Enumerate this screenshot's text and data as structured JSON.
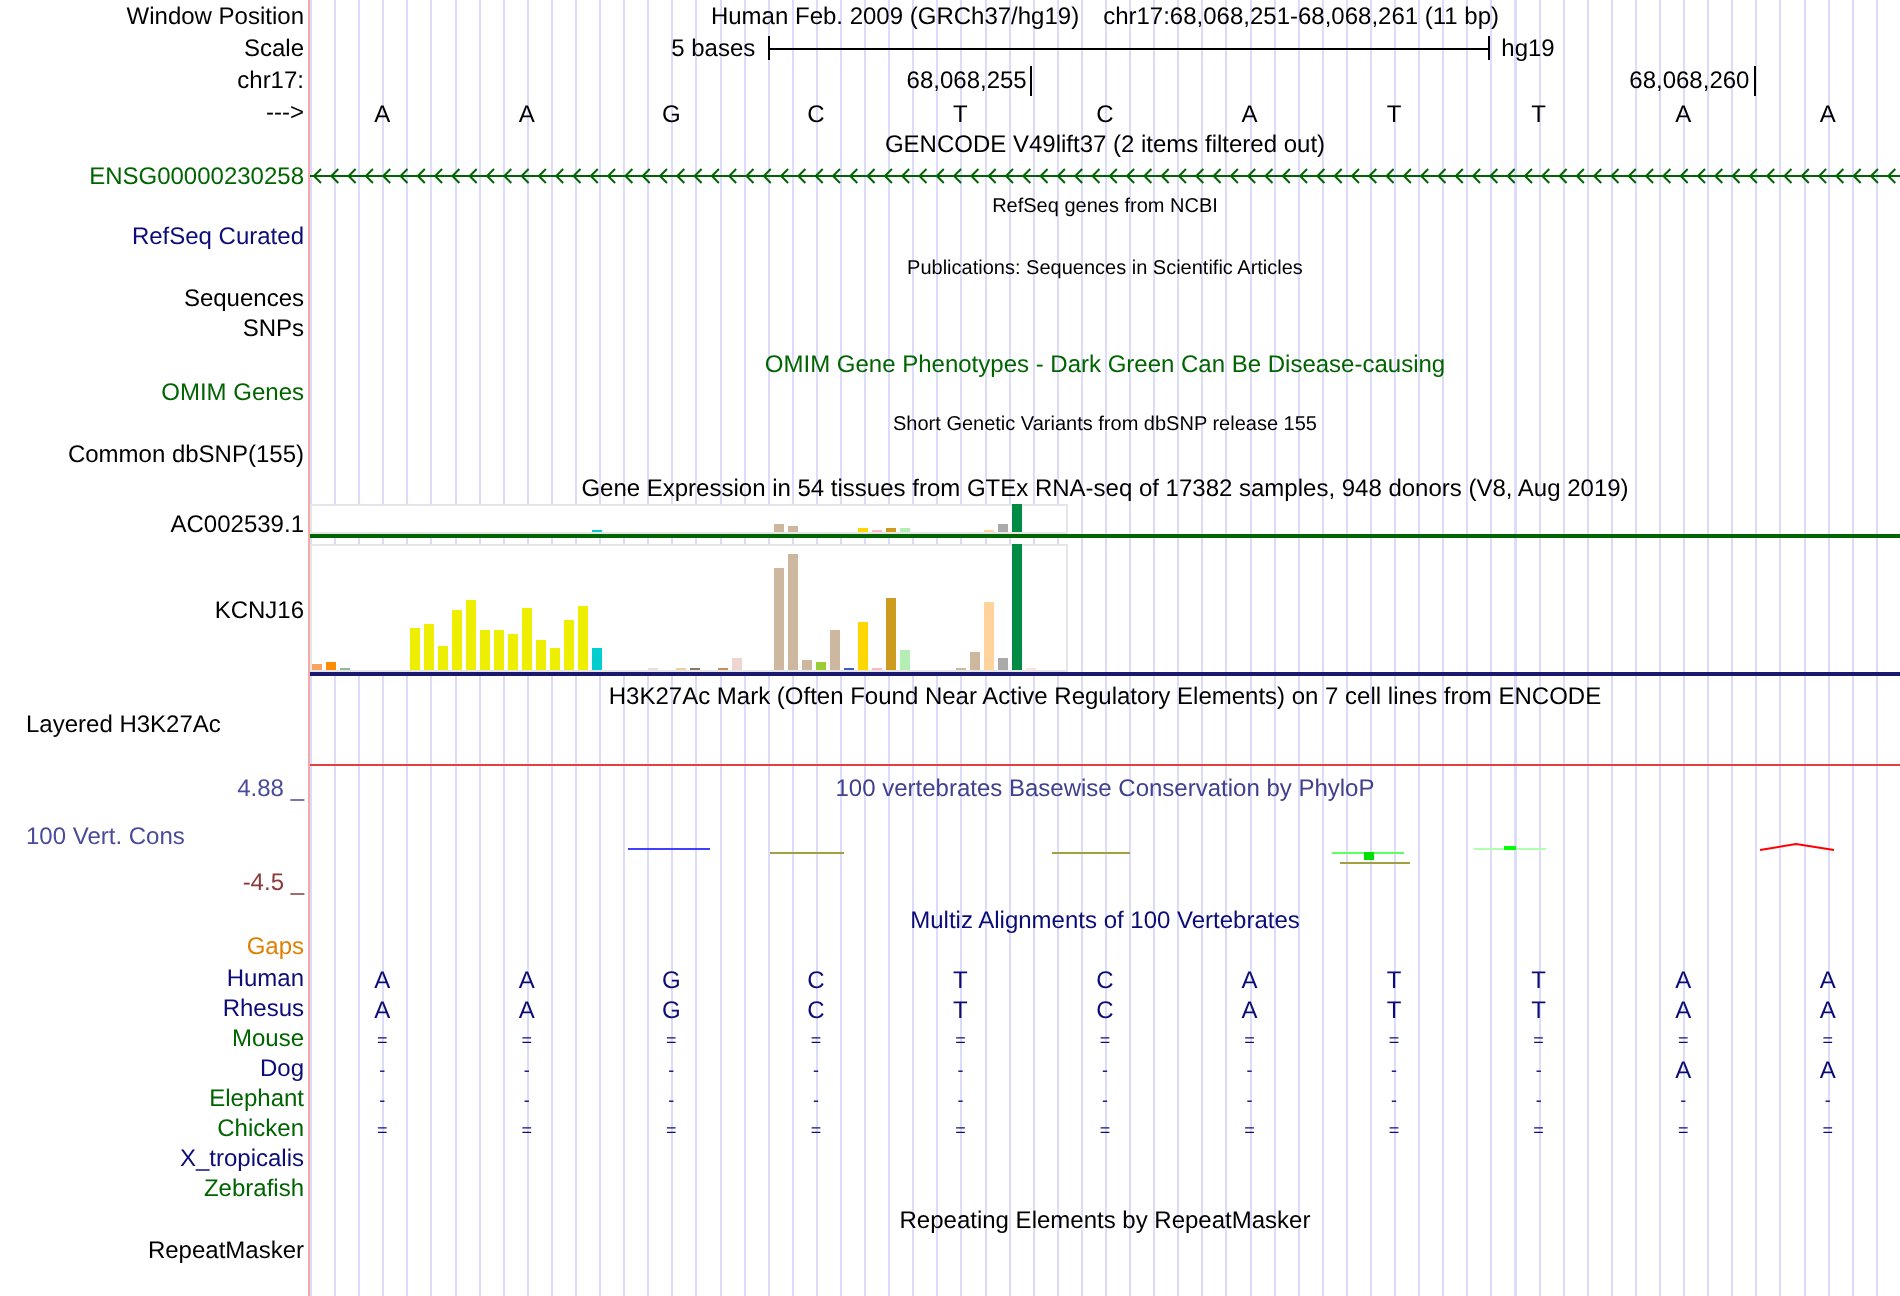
{
  "window_position": {
    "label": "Window Position",
    "assembly": "Human Feb. 2009 (GRCh37/hg19)",
    "range": "chr17:68,068,251-68,068,261 (11 bp)"
  },
  "scale": {
    "label": "Scale",
    "length": "5 bases",
    "assembly": "hg19"
  },
  "ruler": {
    "label": "chr17:",
    "ticks": [
      "68,068,255",
      "68,068,260"
    ]
  },
  "bases": {
    "label": "--->",
    "letters": [
      "A",
      "A",
      "G",
      "C",
      "T",
      "C",
      "A",
      "T",
      "T",
      "A",
      "A"
    ]
  },
  "gencode": {
    "title": "GENCODE V49lift37 (2 items filtered out)",
    "label": "ENSG00000230258"
  },
  "refseq": {
    "title": "RefSeq genes from NCBI",
    "label": "RefSeq Curated"
  },
  "publications": {
    "title": "Publications: Sequences in Scientific Articles",
    "labels": [
      "Sequences",
      "SNPs"
    ]
  },
  "omim": {
    "title": "OMIM Gene Phenotypes - Dark Green Can Be Disease-causing",
    "label": "OMIM Genes"
  },
  "dbsnp": {
    "title": "Short Genetic Variants from dbSNP release 155",
    "label": "Common dbSNP(155)"
  },
  "gtex": {
    "title": "Gene Expression in 54 tissues from GTEx RNA-seq of 17382 samples, 948 donors (V8, Aug 2019)",
    "genes": [
      "AC002539.1",
      "KCNJ16"
    ]
  },
  "h3k27ac": {
    "title": "H3K27Ac Mark (Often Found Near Active Regulatory Elements) on 7 cell lines from ENCODE",
    "label": "Layered H3K27Ac"
  },
  "conservation": {
    "title": "100 vertebrates Basewise Conservation by PhyloP",
    "label": "100 Vert. Cons",
    "max": "4.88 _",
    "min": "-4.5 _"
  },
  "multiz": {
    "title": "Multiz Alignments of 100 Vertebrates",
    "gaps_label": "Gaps",
    "species": [
      {
        "name": "Human",
        "color": "#0c0c78",
        "bases": [
          "A",
          "A",
          "G",
          "C",
          "T",
          "C",
          "A",
          "T",
          "T",
          "A",
          "A"
        ]
      },
      {
        "name": "Rhesus",
        "color": "#0c0c78",
        "bases": [
          "A",
          "A",
          "G",
          "C",
          "T",
          "C",
          "A",
          "T",
          "T",
          "A",
          "A"
        ]
      },
      {
        "name": "Mouse",
        "color": "#006400",
        "bases": [
          "=",
          "=",
          "=",
          "=",
          "=",
          "=",
          "=",
          "=",
          "=",
          "=",
          "="
        ]
      },
      {
        "name": "Dog",
        "color": "#0c0c78",
        "bases": [
          "-",
          "-",
          "-",
          "-",
          "-",
          "-",
          "-",
          "-",
          "-",
          "A",
          "A"
        ]
      },
      {
        "name": "Elephant",
        "color": "#006400",
        "bases": [
          "-",
          "-",
          "-",
          "-",
          "-",
          "-",
          "-",
          "-",
          "-",
          "-",
          "-"
        ]
      },
      {
        "name": "Chicken",
        "color": "#006400",
        "bases": [
          "=",
          "=",
          "=",
          "=",
          "=",
          "=",
          "=",
          "=",
          "=",
          "=",
          "="
        ]
      },
      {
        "name": "X_tropicalis",
        "color": "#0c0c78"
      },
      {
        "name": "Zebrafish",
        "color": "#006400"
      }
    ]
  },
  "repeatmasker": {
    "title": "Repeating Elements by RepeatMasker",
    "label": "RepeatMasker"
  }
}
